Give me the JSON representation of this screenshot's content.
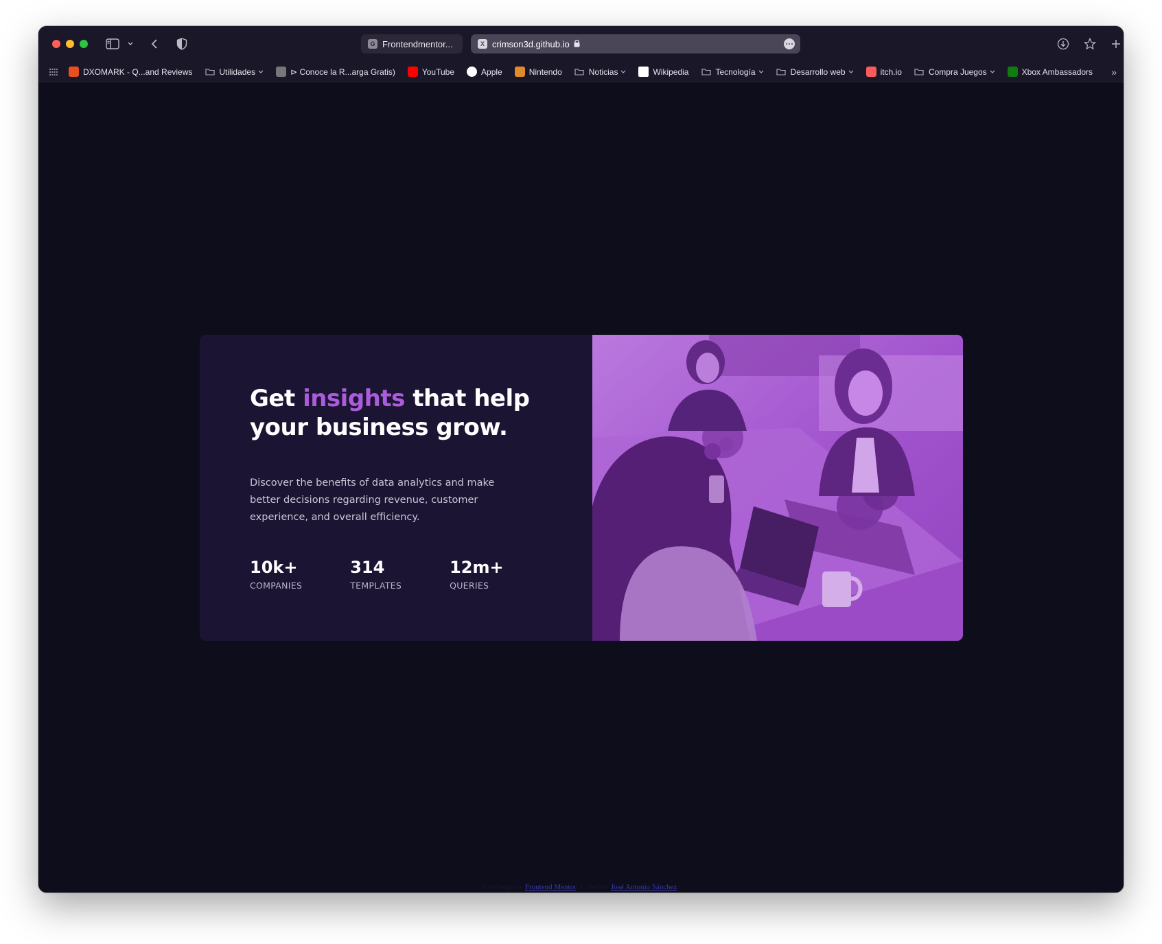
{
  "browser": {
    "tabs": [
      {
        "label": "Frontendmentor...",
        "favicon": "G"
      },
      {
        "label": "crimson3d.github.io",
        "favicon": "X",
        "secure": true
      }
    ],
    "bookmarks": [
      {
        "label": "DXOMARK - Q...and Reviews",
        "icon": "dxomark-icon",
        "color": "#e8501f",
        "folder": false
      },
      {
        "label": "Utilidades",
        "icon": "folder-icon",
        "folder": true
      },
      {
        "label": "⊳ Conoce la R...arga Gratis)",
        "icon": "y-icon",
        "color": "#777777",
        "folder": false
      },
      {
        "label": "YouTube",
        "icon": "youtube-icon",
        "color": "#ff0000",
        "folder": false
      },
      {
        "label": "Apple",
        "icon": "apple-icon",
        "color": "#ffffff",
        "folder": false
      },
      {
        "label": "Nintendo",
        "icon": "mario-icon",
        "color": "#e08a2c",
        "folder": false
      },
      {
        "label": "Noticias",
        "icon": "folder-icon",
        "folder": true
      },
      {
        "label": "Wikipedia",
        "icon": "wikipedia-icon",
        "color": "#ffffff",
        "folder": false
      },
      {
        "label": "Tecnología",
        "icon": "folder-icon",
        "folder": true
      },
      {
        "label": "Desarrollo web",
        "icon": "folder-icon",
        "folder": true
      },
      {
        "label": "itch.io",
        "icon": "itchio-icon",
        "color": "#fa5c5c",
        "folder": false
      },
      {
        "label": "Compra Juegos",
        "icon": "folder-icon",
        "folder": true
      },
      {
        "label": "Xbox Ambassadors",
        "icon": "xbox-icon",
        "color": "#107c10",
        "folder": false
      }
    ]
  },
  "card": {
    "headline_before": "Get ",
    "headline_accent": "insights",
    "headline_after": " that help your business grow.",
    "description": "Discover the benefits of data analytics and make better decisions regarding revenue, customer experience, and overall efficiency.",
    "stats": [
      {
        "value": "10k+",
        "label": "COMPANIES"
      },
      {
        "value": "314",
        "label": "TEMPLATES"
      },
      {
        "value": "12m+",
        "label": "QUERIES"
      }
    ],
    "image_alt": "team-working-photo"
  },
  "attribution": {
    "prefix": "Challenge by ",
    "link1": "Frontend Mentor",
    "middle": ". Coded by ",
    "link2": "José Antonio Sánchez",
    "suffix": "."
  },
  "colors": {
    "page_bg": "#0e0d1c",
    "card_bg": "#1c1433",
    "accent": "#aa5cdb",
    "image_overlay": "#9b48c6"
  }
}
